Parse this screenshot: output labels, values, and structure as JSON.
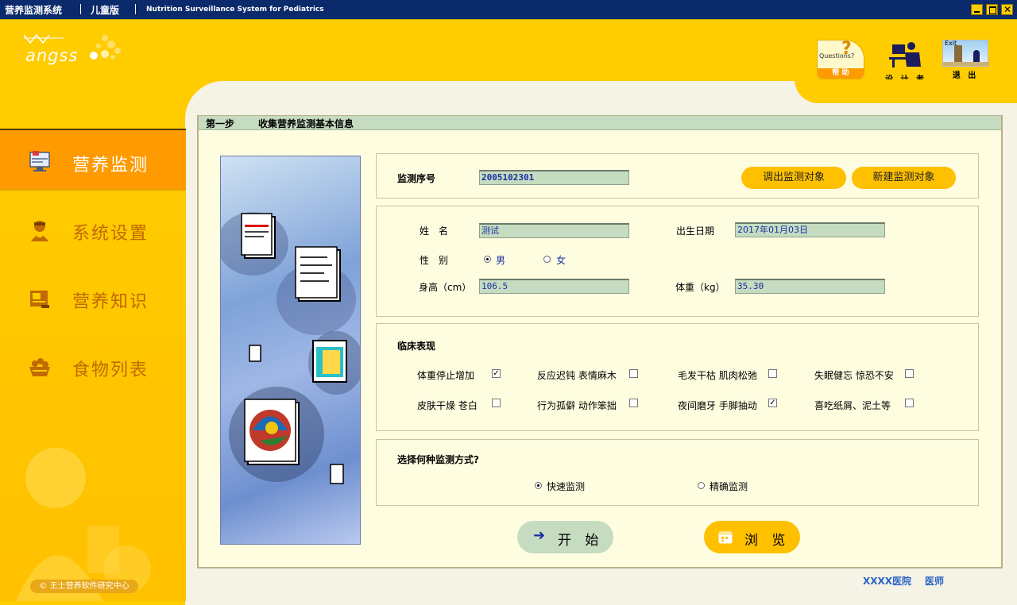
{
  "titlebar": {
    "app_name": "营养监测系统",
    "edition": "儿童版",
    "english_name": "Nutrition Surveillance  System for Pediatrics"
  },
  "logo": {
    "text": "angss"
  },
  "toolbar": {
    "help_label": "帮 助",
    "help_badge": "Questions?",
    "designer_label": "设 计 者",
    "exit_label": "退 出",
    "exit_badge": "Exit"
  },
  "sidebar": {
    "items": [
      {
        "label": "营养监测",
        "icon": "monitor-icon",
        "active": true
      },
      {
        "label": "系统设置",
        "icon": "settings-person-icon",
        "active": false
      },
      {
        "label": "营养知识",
        "icon": "book-icon",
        "active": false
      },
      {
        "label": "食物列表",
        "icon": "food-basket-icon",
        "active": false
      }
    ],
    "copyright": "© 王士营养软件研究中心"
  },
  "step": {
    "number": "第一步",
    "title": "收集营养监测基本信息"
  },
  "monitor": {
    "serial_label": "监测序号",
    "serial_value": "2005102301",
    "load_button": "调出监测对象",
    "new_button": "新建监测对象"
  },
  "basic": {
    "name_label": "姓　名",
    "name_value": "测试",
    "birth_label": "出生日期",
    "birth_value": "2017年01月03日",
    "gender_label": "性　别",
    "gender_options": [
      "男",
      "女"
    ],
    "gender_selected": "男",
    "height_label": "身高（cm）",
    "height_value": "106.5",
    "weight_label": "体重（kg）",
    "weight_value": "35.30"
  },
  "clinical": {
    "title": "临床表现",
    "items": [
      {
        "label": "体重停止增加",
        "checked": true
      },
      {
        "label": "反应迟钝 表情麻木",
        "checked": false
      },
      {
        "label": "毛发干枯 肌肉松弛",
        "checked": false
      },
      {
        "label": "失眠健忘 惊恐不安",
        "checked": false
      },
      {
        "label": "皮肤干燥 苍白",
        "checked": false
      },
      {
        "label": "行为孤僻 动作笨拙",
        "checked": false
      },
      {
        "label": "夜间磨牙 手脚抽动",
        "checked": true
      },
      {
        "label": "喜吃纸屑、泥土等",
        "checked": false
      }
    ]
  },
  "method": {
    "title": "选择何种监测方式?",
    "options": [
      "快速监测",
      "精确监测"
    ],
    "selected": "快速监测"
  },
  "actions": {
    "start": "开 始",
    "browse": "浏 览"
  },
  "footer": {
    "hospital": "XXXX医院",
    "doctor": "医师"
  },
  "colors": {
    "accent": "#ffcc00",
    "active_nav": "#ff9a00",
    "field_bg": "#c5dcc0",
    "titlebar": "#0a2a6b"
  }
}
